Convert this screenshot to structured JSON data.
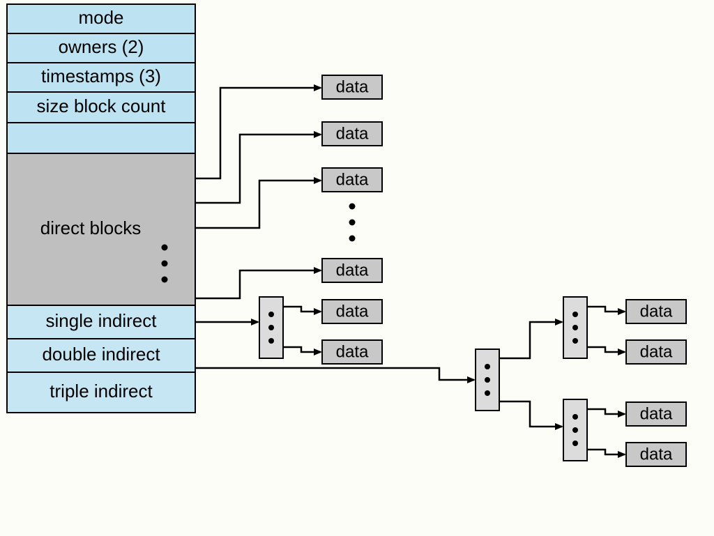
{
  "inode_header_fields": [
    "mode",
    "owners (2)",
    "timestamps (3)",
    "size block count",
    ""
  ],
  "direct_blocks_label": "direct blocks",
  "tail_fields": [
    "single indirect",
    "double indirect",
    "triple indirect"
  ],
  "data_label": "data"
}
